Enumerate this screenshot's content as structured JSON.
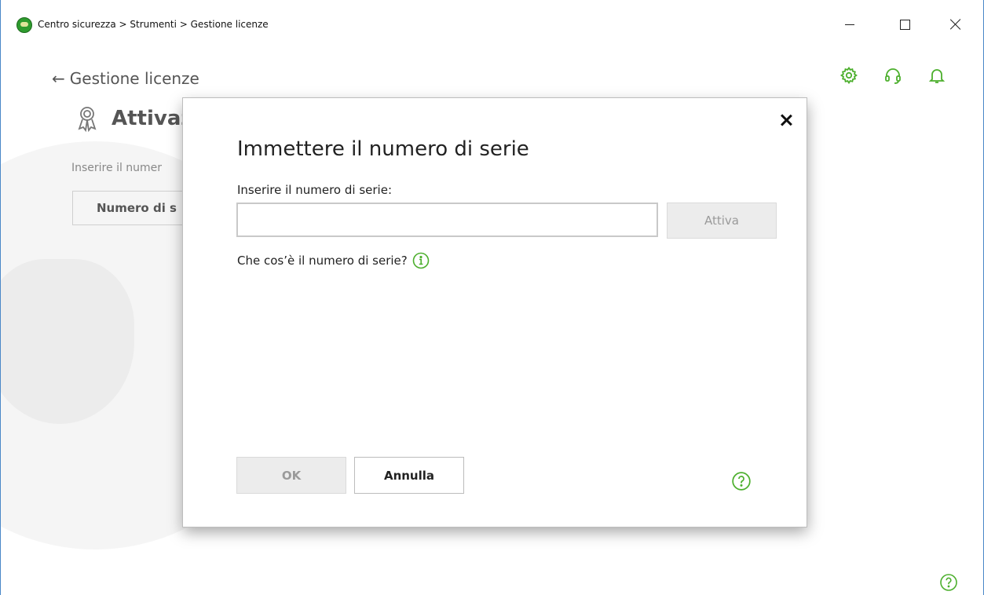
{
  "window": {
    "title": "Centro sicurezza > Strumenti > Gestione licenze"
  },
  "page": {
    "back_label": "Gestione licenze",
    "title": "Attivaz",
    "hint": "Inserire il numer",
    "serial_button_label": "Numero di s"
  },
  "dialog": {
    "title": "Immettere il numero di serie",
    "field_label": "Inserire il numero di serie:",
    "serial_value": "",
    "activate_label": "Attiva",
    "info_link": "Che cos’è il numero di serie?",
    "ok_label": "OK",
    "cancel_label": "Annulla"
  },
  "colors": {
    "accent_green": "#4caf2d",
    "disabled_text": "#9a9a9a",
    "window_border": "#4a87c8"
  },
  "icons": [
    "app-logo-icon",
    "settings-icon",
    "support-headset-icon",
    "notification-bell-icon",
    "back-arrow-icon",
    "certificate-icon",
    "info-icon",
    "help-icon",
    "close-icon"
  ]
}
